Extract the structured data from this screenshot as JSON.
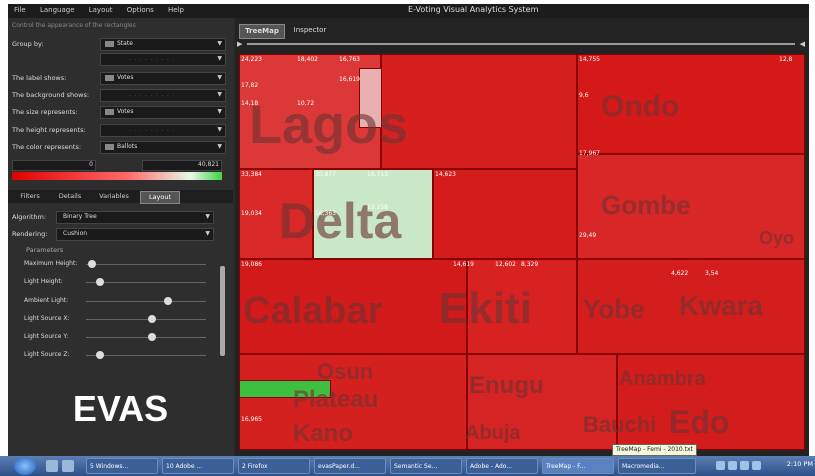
{
  "app": {
    "title": "E-Voting Visual Analytics System",
    "logo": "EVAS"
  },
  "menu": [
    "File",
    "Language",
    "Layout",
    "Options",
    "Help"
  ],
  "left_panel": {
    "subtitle": "Control the appearance of the rectangles",
    "group_by": {
      "label": "Group by:",
      "value": "State",
      "second_value": "- - - - - - - - -"
    },
    "label_shows": {
      "label": "The label shows:",
      "value": "Votes"
    },
    "background_shows": {
      "label": "The background shows:",
      "value": "- - - - - - - - -"
    },
    "size_represents": {
      "label": "The size represents:",
      "value": "Votes"
    },
    "height_represents": {
      "label": "The height represents:",
      "value": "- - - - - - - - -"
    },
    "color_represents": {
      "label": "The color represents:",
      "value": "Ballots"
    },
    "range_min": "0",
    "range_max": "40,821",
    "tabs": [
      "Filters",
      "Details",
      "Variables",
      "Layout"
    ],
    "algorithm": {
      "label": "Algorithm:",
      "value": "Binary Tree"
    },
    "rendering": {
      "label": "Rendering:",
      "value": "Cushion"
    },
    "parameters_heading": "Parameters",
    "sliders": [
      {
        "label": "Maximum Height:",
        "level": 0.05
      },
      {
        "label": "Light Height:",
        "level": 0.12
      },
      {
        "label": "Ambient Light:",
        "level": 0.68
      },
      {
        "label": "Light Source X:",
        "level": 0.55
      },
      {
        "label": "Light Source Y:",
        "level": 0.55
      },
      {
        "label": "Light Source Z:",
        "level": 0.12
      }
    ]
  },
  "view_tabs": [
    "TreeMap",
    "Inspector"
  ],
  "treemap": {
    "states": [
      "Lagos",
      "Ondo",
      "Delta",
      "Gombe",
      "Calabar",
      "Ekiti",
      "Yobe",
      "Kwara",
      "Osun",
      "Plateau",
      "Enugu",
      "Anambra",
      "Kano",
      "Abuja",
      "Bauchi",
      "Edo",
      "Oyo"
    ],
    "numbers": [
      "24,223",
      "18,402",
      "16,763",
      "14,755",
      "12,8",
      "17,82",
      "14,18",
      "10,72",
      "16,619",
      "9,6",
      "17,967",
      "33,384",
      "30,877",
      "16,713",
      "14,623",
      "19,034",
      "16,363",
      "13,258",
      "19,086",
      "14,619",
      "16,965",
      "12,602",
      "8,329",
      "4,622",
      "3,54",
      "29,49"
    ]
  },
  "tooltip": "TreeMap - Femi - 2010.txt",
  "taskbar": {
    "buttons": [
      "5 Windows...",
      "10 Adobe ...",
      "2 Firefox",
      "evasPaper.d...",
      "Semantic Se...",
      "Adobe - Ado...",
      "TreeMap - F...",
      "Macromedia..."
    ],
    "clock": "2:10 PM"
  },
  "colors": {
    "accent_red": "#d81a1a",
    "highlight_green": "#3fbf3f",
    "pale_green": "#c8e8c8"
  }
}
